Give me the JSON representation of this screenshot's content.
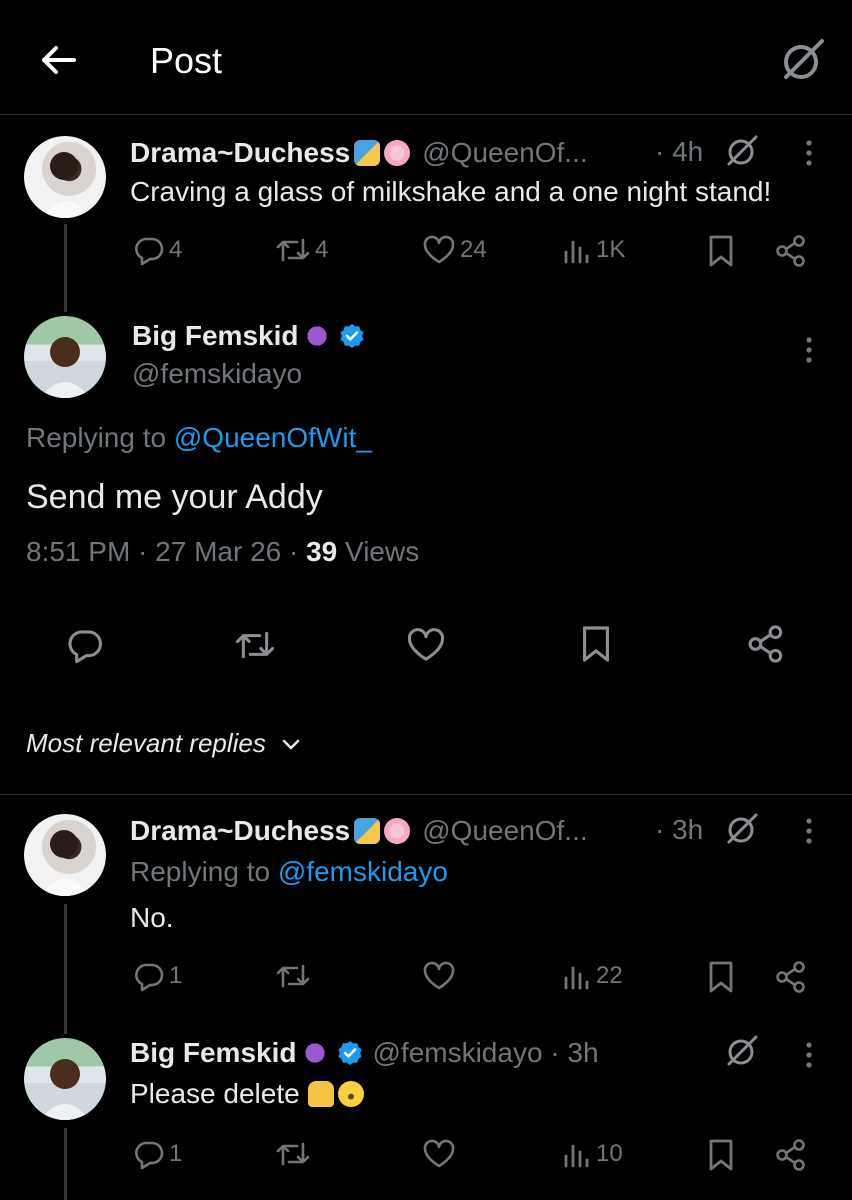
{
  "header": {
    "title": "Post"
  },
  "parent": {
    "name": "Drama~Duchess",
    "handle": "@QueenOf...",
    "time": "· 4h",
    "text": "Craving a glass of milkshake and a one night stand!",
    "replies": "4",
    "reposts": "4",
    "likes": "24",
    "views": "1K"
  },
  "main": {
    "name": "Big Femskid",
    "handle": "@femskidayo",
    "replying_label": "Replying to ",
    "replying_to": "@QueenOfWit_",
    "text": "Send me your Addy",
    "meta_time": "8:51 PM · 27 Mar 26 · ",
    "meta_views_count": "39",
    "meta_views_label": " Views"
  },
  "sort": {
    "label": "Most relevant replies"
  },
  "reply1": {
    "name": "Drama~Duchess",
    "handle": "@QueenOf...",
    "time": "· 3h",
    "replying_label": "Replying to ",
    "replying_to": "@femskidayo",
    "text": "No.",
    "replies": "1",
    "views": "22"
  },
  "reply2": {
    "name": "Big Femskid",
    "handle": "@femskidayo · 3h",
    "text": "Please delete",
    "replies": "1",
    "views": "10"
  },
  "colors": {
    "link": "#1d9bf0",
    "verified": "#1d9bf0",
    "muted": "#71767b",
    "background": "#000000"
  }
}
